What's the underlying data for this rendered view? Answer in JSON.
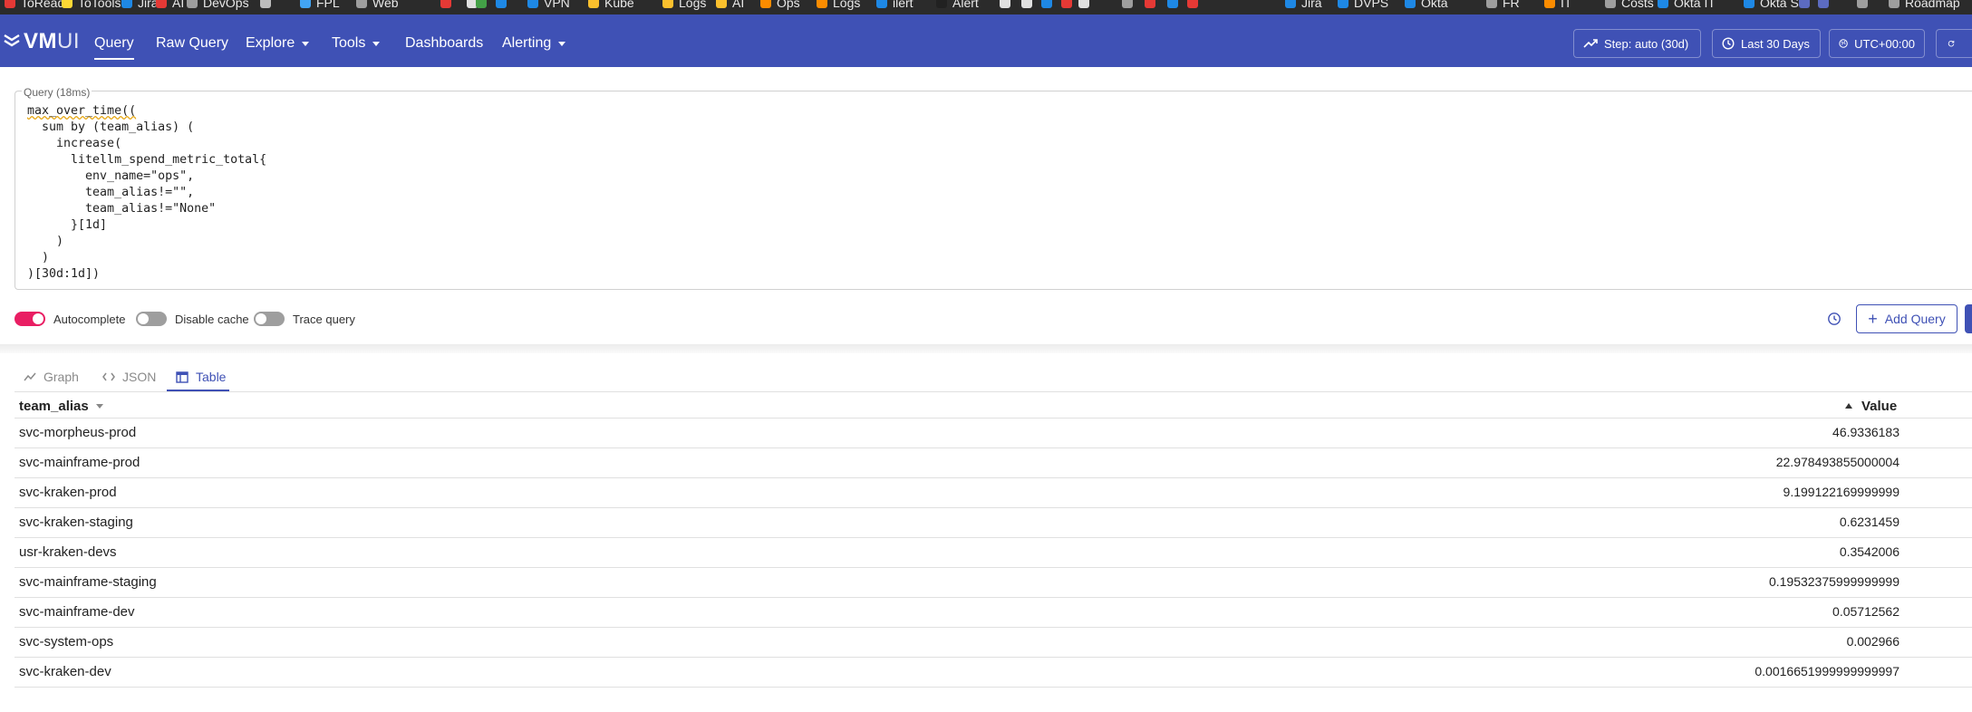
{
  "bookmarks": [
    {
      "label": "ToRead",
      "color": "#e53935"
    },
    {
      "label": "ToTools",
      "color": "#fdd835"
    },
    {
      "label": "Jira",
      "color": "#1e88e5"
    },
    {
      "label": "AI",
      "color": "#e53935"
    },
    {
      "label": "DevOps",
      "color": "#9e9e9e"
    },
    {
      "label": "",
      "color": "#bdbdbd"
    },
    {
      "label": "FPL",
      "color": "#42a5f5"
    },
    {
      "label": "Web",
      "color": "#9e9e9e"
    },
    {
      "label": "",
      "color": "#e53935"
    },
    {
      "label": "",
      "color": "#e0e0e0"
    },
    {
      "label": "",
      "color": "#43a047"
    },
    {
      "label": "",
      "color": "#1e88e5"
    },
    {
      "label": "VPN",
      "color": "#1e88e5"
    },
    {
      "label": "Kube",
      "color": "#fbc02d"
    },
    {
      "label": "Logs",
      "color": "#fbc02d"
    },
    {
      "label": "AI",
      "color": "#fbc02d"
    },
    {
      "label": "Ops",
      "color": "#fb8c00"
    },
    {
      "label": "Logs",
      "color": "#fb8c00"
    },
    {
      "label": "ilert",
      "color": "#1e88e5"
    },
    {
      "label": "Alert",
      "color": "#212121"
    },
    {
      "label": "",
      "color": "#e0e0e0"
    },
    {
      "label": "",
      "color": "#e0e0e0"
    },
    {
      "label": "",
      "color": "#1e88e5"
    },
    {
      "label": "",
      "color": "#e53935"
    },
    {
      "label": "",
      "color": "#e0e0e0"
    },
    {
      "label": "",
      "color": "#9e9e9e"
    },
    {
      "label": "",
      "color": "#e53935"
    },
    {
      "label": "",
      "color": "#1e88e5"
    },
    {
      "label": "",
      "color": "#e53935"
    },
    {
      "label": "Jira",
      "color": "#1e88e5"
    },
    {
      "label": "DVPS",
      "color": "#1e88e5"
    },
    {
      "label": "Okta",
      "color": "#1e88e5"
    },
    {
      "label": "FR",
      "color": "#9e9e9e"
    },
    {
      "label": "IT",
      "color": "#fb8c00"
    },
    {
      "label": "Costs",
      "color": "#9e9e9e"
    },
    {
      "label": "Okta IT",
      "color": "#1e88e5"
    },
    {
      "label": "Okta S",
      "color": "#1e88e5"
    },
    {
      "label": "",
      "color": "#5c6bc0"
    },
    {
      "label": "",
      "color": "#5c6bc0"
    },
    {
      "label": "",
      "color": "#9e9e9e"
    },
    {
      "label": "Roadmap",
      "color": "#9e9e9e"
    }
  ],
  "header": {
    "logo_main": "VM",
    "logo_sub": "UI",
    "nav": [
      {
        "label": "Query",
        "dropdown": false,
        "active": true
      },
      {
        "label": "Raw Query",
        "dropdown": false,
        "active": false
      },
      {
        "label": "Explore",
        "dropdown": true,
        "active": false
      },
      {
        "label": "Tools",
        "dropdown": true,
        "active": false
      },
      {
        "label": "Dashboards",
        "dropdown": false,
        "active": false
      },
      {
        "label": "Alerting",
        "dropdown": true,
        "active": false
      }
    ],
    "step_label": "Step: auto (30d)",
    "time_range_label": "Last 30 Days",
    "timezone_label": "UTC+00:00"
  },
  "query": {
    "legend": "Query (18ms)",
    "lines": [
      "max_over_time((",
      "  sum by (team_alias) (",
      "    increase(",
      "      litellm_spend_metric_total{",
      "        env_name=\"ops\",",
      "        team_alias!=\"\",",
      "        team_alias!=\"None\"",
      "      }[1d]",
      "    )",
      "  )",
      ")[30d:1d])"
    ]
  },
  "toggles": {
    "autocomplete": {
      "label": "Autocomplete",
      "on": true
    },
    "disable_cache": {
      "label": "Disable cache",
      "on": false
    },
    "trace_query": {
      "label": "Trace query",
      "on": false
    }
  },
  "add_query_label": "Add Query",
  "tabs": {
    "graph": "Graph",
    "json": "JSON",
    "table": "Table",
    "active": "Table"
  },
  "table": {
    "col_name": "team_alias",
    "col_value": "Value",
    "rows": [
      {
        "name": "svc-morpheus-prod",
        "value": "46.9336183"
      },
      {
        "name": "svc-mainframe-prod",
        "value": "22.978493855000004"
      },
      {
        "name": "svc-kraken-prod",
        "value": "9.199122169999999"
      },
      {
        "name": "svc-kraken-staging",
        "value": "0.6231459"
      },
      {
        "name": "usr-kraken-devs",
        "value": "0.3542006"
      },
      {
        "name": "svc-mainframe-staging",
        "value": "0.19532375999999999"
      },
      {
        "name": "svc-mainframe-dev",
        "value": "0.05712562"
      },
      {
        "name": "svc-system-ops",
        "value": "0.002966"
      },
      {
        "name": "svc-kraken-dev",
        "value": "0.0016651999999999997"
      }
    ]
  },
  "colors": {
    "header_bg": "#3f51b5",
    "accent": "#3f51b5",
    "toggle_on": "#e91e63",
    "toggle_off": "#9e9e9e"
  }
}
